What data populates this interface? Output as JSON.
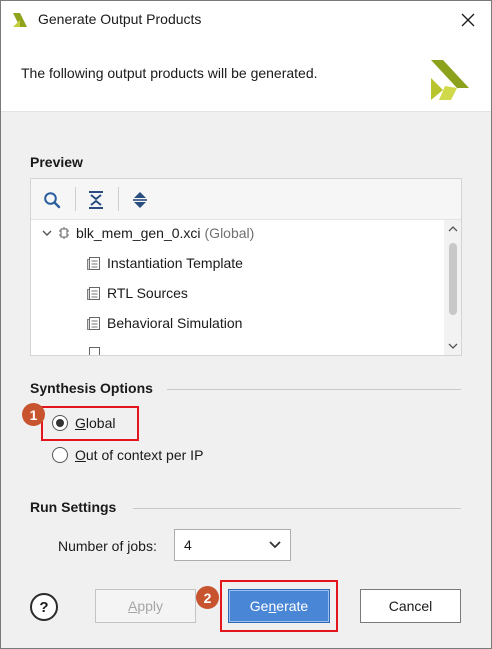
{
  "window": {
    "title": "Generate Output Products"
  },
  "header": {
    "message": "The following output products will be generated."
  },
  "preview": {
    "label": "Preview",
    "toolbar": {
      "search_icon": "search-icon",
      "collapse_icon": "collapse-all-icon",
      "expand_icon": "expand-all-icon"
    },
    "root": {
      "name": "blk_mem_gen_0.xci",
      "scope": "(Global)"
    },
    "items": [
      "Instantiation Template",
      "RTL Sources",
      "Behavioral Simulation"
    ]
  },
  "synthesis": {
    "label": "Synthesis Options",
    "options": [
      {
        "mnemonic": "G",
        "rest": "lobal",
        "selected": true
      },
      {
        "mnemonic": "O",
        "rest": "ut of context per IP",
        "selected": false
      }
    ]
  },
  "run": {
    "label": "Run Settings",
    "jobs_label_pre": "Number of ",
    "jobs_label_mn": "j",
    "jobs_label_post": "obs:",
    "jobs_value": "4"
  },
  "buttons": {
    "help": "?",
    "apply_mn": "A",
    "apply_rest": "pply",
    "generate_pre": "Ge",
    "generate_mn": "n",
    "generate_post": "erate",
    "cancel": "Cancel"
  },
  "annotations": {
    "step1": "1",
    "step2": "2"
  },
  "colors": {
    "accent": "#4a86d6",
    "highlight": "#e4151c",
    "badge": "#c8542f",
    "brand": "#9aae1e"
  }
}
